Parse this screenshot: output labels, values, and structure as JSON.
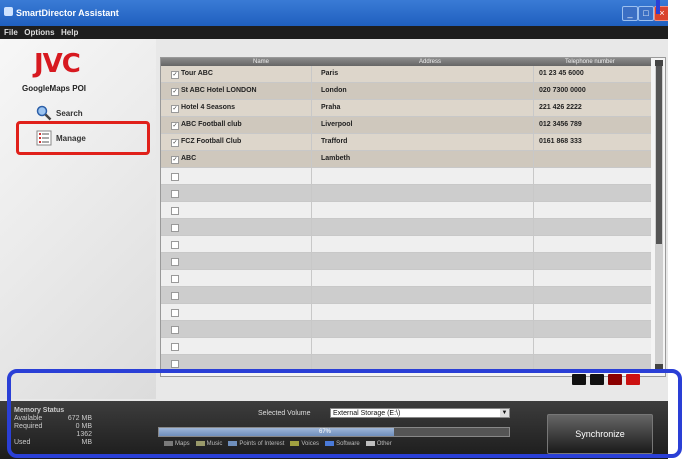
{
  "window": {
    "title": "SmartDirector Assistant",
    "controls": [
      "minimize-icon",
      "maximize-icon",
      "close-icon"
    ]
  },
  "menu": [
    "File",
    "Options",
    "Help"
  ],
  "sidebar": {
    "logo": "JVC",
    "product": "GoogleMaps POI",
    "items": [
      {
        "label": "Search",
        "icon": "magnifier-icon"
      },
      {
        "label": "Manage",
        "icon": "list-icon"
      }
    ]
  },
  "table": {
    "columns": [
      "Name",
      "Address",
      "Telephone number"
    ],
    "rows": [
      {
        "checked": true,
        "name": "Tour ABC",
        "address": "Paris",
        "phone": "01 23 45 6000"
      },
      {
        "checked": true,
        "name": "St ABC Hotel LONDON",
        "address": "London",
        "phone": "020 7300 0000"
      },
      {
        "checked": true,
        "name": "Hotel 4 Seasons",
        "address": "Praha",
        "phone": "221 426 2222"
      },
      {
        "checked": true,
        "name": "ABC Football club",
        "address": "Liverpool",
        "phone": "012 3456 789"
      },
      {
        "checked": true,
        "name": "FCZ Football Club",
        "address": "Trafford",
        "phone": "0161 868 333"
      },
      {
        "checked": true,
        "name": "ABC",
        "address": "Lambeth",
        "phone": ""
      },
      {
        "checked": false,
        "name": "",
        "address": "",
        "phone": ""
      },
      {
        "checked": false,
        "name": "",
        "address": "",
        "phone": ""
      },
      {
        "checked": false,
        "name": "",
        "address": "",
        "phone": ""
      },
      {
        "checked": false,
        "name": "",
        "address": "",
        "phone": ""
      },
      {
        "checked": false,
        "name": "",
        "address": "",
        "phone": ""
      },
      {
        "checked": false,
        "name": "",
        "address": "",
        "phone": ""
      },
      {
        "checked": false,
        "name": "",
        "address": "",
        "phone": ""
      },
      {
        "checked": false,
        "name": "",
        "address": "",
        "phone": ""
      },
      {
        "checked": false,
        "name": "",
        "address": "",
        "phone": ""
      },
      {
        "checked": false,
        "name": "",
        "address": "",
        "phone": ""
      },
      {
        "checked": false,
        "name": "",
        "address": "",
        "phone": ""
      },
      {
        "checked": false,
        "name": "",
        "address": "",
        "phone": ""
      }
    ]
  },
  "row_actions": [
    {
      "icon": "move-up-icon",
      "color": "#111111"
    },
    {
      "icon": "move-down-icon",
      "color": "#111111"
    },
    {
      "icon": "edit-icon",
      "color": "#8b0000"
    },
    {
      "icon": "delete-icon",
      "color": "#cc1111"
    }
  ],
  "memory": {
    "title": "Memory Status",
    "rows": [
      {
        "label": "Available",
        "value": "672 MB"
      },
      {
        "label": "Required",
        "value": "0 MB"
      },
      {
        "label": "Used",
        "value": "1362 MB"
      }
    ]
  },
  "volume": {
    "label": "Selected Volume",
    "value": "External Storage (E:\\)"
  },
  "usage": {
    "percent_label": "67%",
    "percent": 67
  },
  "legend": [
    {
      "label": "Maps",
      "color": "#7a7a7a"
    },
    {
      "label": "Music",
      "color": "#9a9a6a"
    },
    {
      "label": "Points of Interest",
      "color": "#6f8fbc"
    },
    {
      "label": "Voices",
      "color": "#a0a040"
    },
    {
      "label": "Software",
      "color": "#4a7ad8"
    },
    {
      "label": "Other",
      "color": "#bfbfbf"
    }
  ],
  "sync_button": "Synchronize",
  "annotations": {
    "red_box_color": "#e0201a",
    "blue_box_color": "#2a3fd6"
  }
}
